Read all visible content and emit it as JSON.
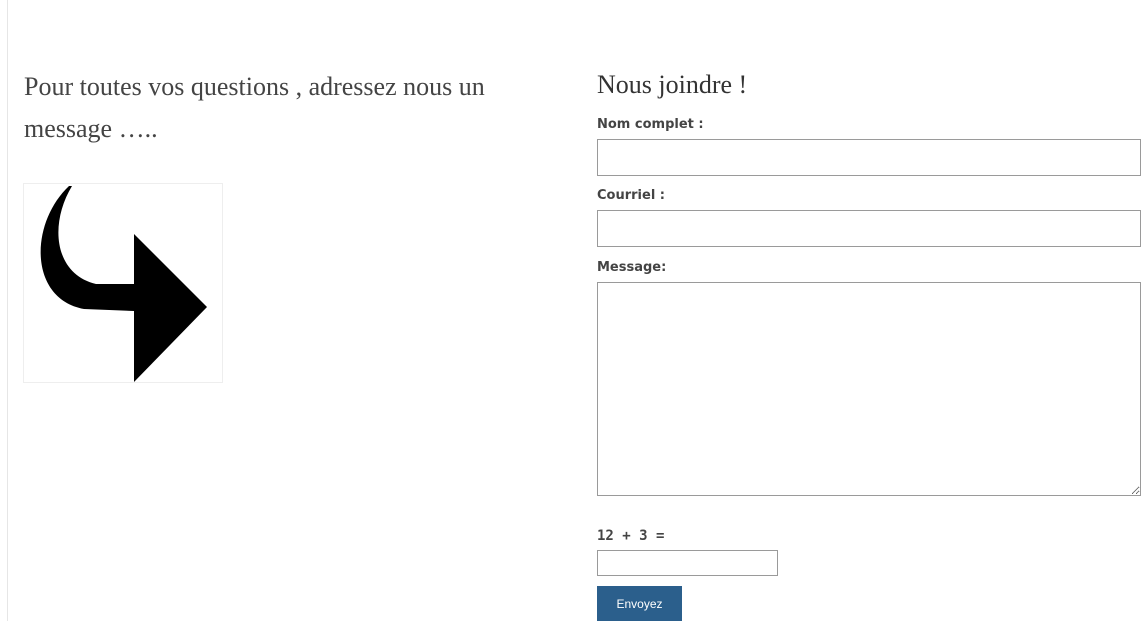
{
  "intro": {
    "text_line1": "Pour toutes vos questions , adressez nous un",
    "text_line2": "message ….."
  },
  "illustration": {
    "icon": "curved-arrow-right-icon",
    "color": "#000000"
  },
  "form": {
    "title": "Nous joindre !",
    "name_label": "Nom complet :",
    "name_value": "",
    "email_label": "Courriel :",
    "email_value": "",
    "message_label": "Message:",
    "message_value": "",
    "captcha_question": "12 + 3 =",
    "captcha_value": "",
    "submit_label": "Envoyez",
    "submit_color": "#2b5f8c"
  }
}
